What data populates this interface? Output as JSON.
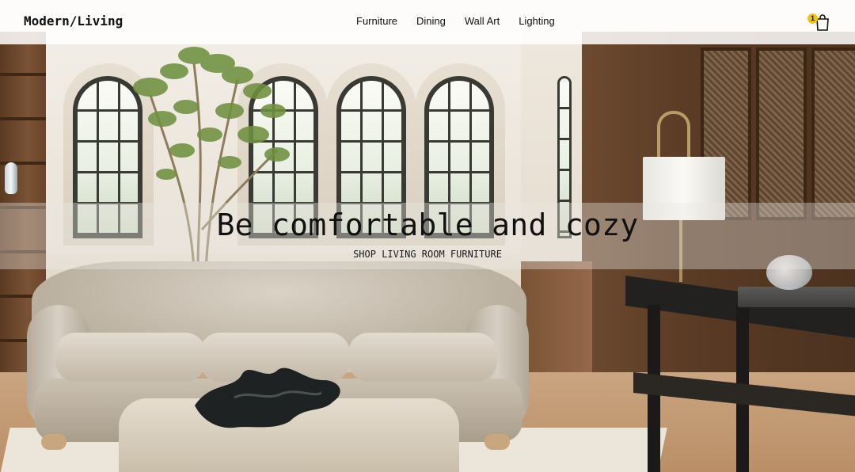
{
  "header": {
    "brand": "Modern/Living",
    "nav": [
      {
        "label": "Furniture"
      },
      {
        "label": "Dining"
      },
      {
        "label": "Wall Art"
      },
      {
        "label": "Lighting"
      }
    ],
    "cart_count": "1"
  },
  "hero": {
    "title": "Be comfortable and cozy",
    "cta": "SHOP LIVING ROOM FURNITURE"
  },
  "colors": {
    "text": "#111111",
    "header_bg": "#ffffff",
    "cart_badge": "#f0c419"
  },
  "icons": {
    "cart": "shopping-bag-icon"
  }
}
